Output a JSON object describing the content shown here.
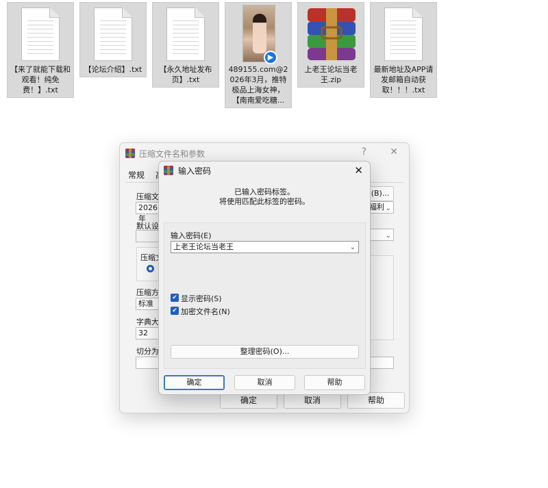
{
  "desktop": {
    "files": [
      {
        "label": "【来了就能下载和观看！纯免费！】.txt",
        "kind": "txt"
      },
      {
        "label": "【论坛介绍】.txt",
        "kind": "txt"
      },
      {
        "label": "【永久地址发布页】.txt",
        "kind": "txt"
      },
      {
        "label": "489155.com@2026年3月，推特极品上海女神，【南南爱吃糖...",
        "kind": "video"
      },
      {
        "label": "上老王论坛当老王.zip",
        "kind": "archive"
      },
      {
        "label": "最新地址及APP请发邮箱自动获取！！！.txt",
        "kind": "txt"
      }
    ]
  },
  "archive_dialog": {
    "title": "压缩文件名和参数",
    "help_glyph": "?",
    "tab_general": "常规",
    "tab_advanced_partial": "高",
    "archive_name_label": "压缩文件",
    "archive_name_value": "2026年",
    "browse_button": "(B)...",
    "update_mode_value": "福利",
    "default_settings_label": "默认设置",
    "format_group_label": "压缩文",
    "method_label": "压缩方式",
    "method_value": "标准",
    "dict_label": "字典大小",
    "dict_value": "32",
    "split_label": "切分为分",
    "ok_button": "确定",
    "cancel_button": "取消",
    "help_button": "帮助"
  },
  "password_dialog": {
    "title": "输入密码",
    "info_line1": "已输入密码标签。",
    "info_line2": "将使用匹配此标签的密码。",
    "password_label": "输入密码(E)",
    "password_value": "上老王论坛当老王",
    "show_password_label": "显示密码(S)",
    "show_password_checked": true,
    "encrypt_names_label": "加密文件名(N)",
    "encrypt_names_checked": true,
    "organize_button": "整理密码(O)...",
    "ok_button": "确定",
    "cancel_button": "取消",
    "help_button": "帮助"
  },
  "icons": {
    "document": "document-icon",
    "archive": "winrar-archive-icon",
    "video_badge": "play-badge-icon",
    "app": "winrar-app-icon",
    "close": "close-icon",
    "dropdown": "chevron-down-icon",
    "check": "checkmark-icon"
  }
}
